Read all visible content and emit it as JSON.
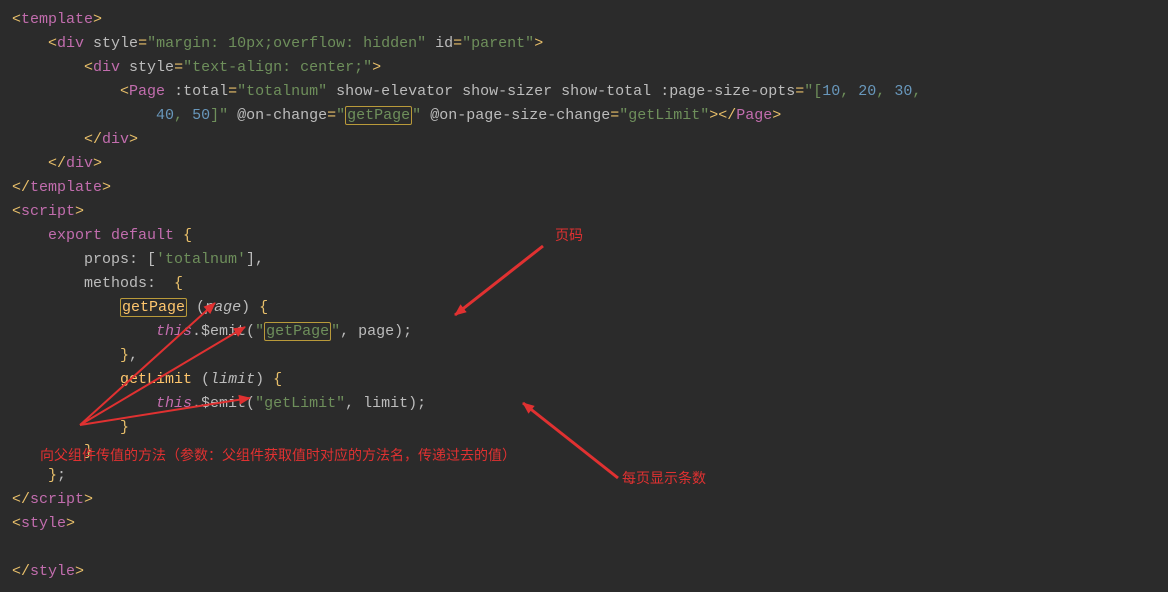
{
  "code": {
    "lines": [
      {
        "indent": 0,
        "tokens": [
          {
            "t": "pn",
            "v": "<"
          },
          {
            "t": "tag",
            "v": "template"
          },
          {
            "t": "pn",
            "v": ">"
          }
        ]
      },
      {
        "indent": 1,
        "tokens": [
          {
            "t": "pn",
            "v": "<"
          },
          {
            "t": "tag",
            "v": "div "
          },
          {
            "t": "attr",
            "v": "style"
          },
          {
            "t": "pn",
            "v": "="
          },
          {
            "t": "str",
            "v": "\"margin: 10px;overflow: hidden\""
          },
          {
            "t": "plain",
            "v": " "
          },
          {
            "t": "attr",
            "v": "id"
          },
          {
            "t": "pn",
            "v": "="
          },
          {
            "t": "str",
            "v": "\"parent\""
          },
          {
            "t": "pn",
            "v": ">"
          }
        ]
      },
      {
        "indent": 2,
        "tokens": [
          {
            "t": "pn",
            "v": "<"
          },
          {
            "t": "tag",
            "v": "div "
          },
          {
            "t": "attr",
            "v": "style"
          },
          {
            "t": "pn",
            "v": "="
          },
          {
            "t": "str",
            "v": "\"text-align: center;\""
          },
          {
            "t": "pn",
            "v": ">"
          }
        ]
      },
      {
        "indent": 3,
        "tokens": [
          {
            "t": "pn",
            "v": "<"
          },
          {
            "t": "tag",
            "v": "Page "
          },
          {
            "t": "attr",
            "v": ":total"
          },
          {
            "t": "pn",
            "v": "="
          },
          {
            "t": "str",
            "v": "\"totalnum\""
          },
          {
            "t": "plain",
            "v": " "
          },
          {
            "t": "attr",
            "v": "show-elevator show-sizer show-total "
          },
          {
            "t": "attr",
            "v": ":page-size-opts"
          },
          {
            "t": "pn",
            "v": "="
          },
          {
            "t": "str",
            "v": "\"["
          },
          {
            "t": "num",
            "v": "10"
          },
          {
            "t": "str",
            "v": ", "
          },
          {
            "t": "num",
            "v": "20"
          },
          {
            "t": "str",
            "v": ", "
          },
          {
            "t": "num",
            "v": "30"
          },
          {
            "t": "str",
            "v": ","
          }
        ]
      },
      {
        "indent": 4,
        "tokens": [
          {
            "t": "num",
            "v": "40"
          },
          {
            "t": "str",
            "v": ", "
          },
          {
            "t": "num",
            "v": "50"
          },
          {
            "t": "str",
            "v": "]\""
          },
          {
            "t": "plain",
            "v": " "
          },
          {
            "t": "attr",
            "v": "@on-change"
          },
          {
            "t": "pn",
            "v": "="
          },
          {
            "t": "str",
            "v": "\""
          },
          {
            "t": "mark-str",
            "v": "getPage"
          },
          {
            "t": "str",
            "v": "\""
          },
          {
            "t": "plain",
            "v": " "
          },
          {
            "t": "attr",
            "v": "@on-page-size-change"
          },
          {
            "t": "pn",
            "v": "="
          },
          {
            "t": "str",
            "v": "\"getLimit\""
          },
          {
            "t": "pn",
            "v": "></"
          },
          {
            "t": "tag",
            "v": "Page"
          },
          {
            "t": "pn",
            "v": ">"
          }
        ]
      },
      {
        "indent": 2,
        "tokens": [
          {
            "t": "pn",
            "v": "</"
          },
          {
            "t": "tag",
            "v": "div"
          },
          {
            "t": "pn",
            "v": ">"
          }
        ]
      },
      {
        "indent": 1,
        "tokens": [
          {
            "t": "pn",
            "v": "</"
          },
          {
            "t": "tag",
            "v": "div"
          },
          {
            "t": "pn",
            "v": ">"
          }
        ]
      },
      {
        "indent": 0,
        "tokens": [
          {
            "t": "pn",
            "v": "</"
          },
          {
            "t": "tag",
            "v": "template"
          },
          {
            "t": "pn",
            "v": ">"
          }
        ]
      },
      {
        "indent": 0,
        "tokens": [
          {
            "t": "pn",
            "v": "<"
          },
          {
            "t": "tag",
            "v": "script"
          },
          {
            "t": "pn",
            "v": ">"
          }
        ]
      },
      {
        "indent": 1,
        "tokens": [
          {
            "t": "kw",
            "v": "export default "
          },
          {
            "t": "pn",
            "v": "{"
          }
        ]
      },
      {
        "indent": 2,
        "tokens": [
          {
            "t": "plain",
            "v": "props: ["
          },
          {
            "t": "str",
            "v": "'totalnum'"
          },
          {
            "t": "plain",
            "v": "],"
          }
        ]
      },
      {
        "indent": 2,
        "tokens": [
          {
            "t": "plain",
            "v": "methods:  "
          },
          {
            "t": "pn",
            "v": "{"
          }
        ]
      },
      {
        "indent": 3,
        "tokens": [
          {
            "t": "mark-fn",
            "v": "getPage"
          },
          {
            "t": "plain",
            "v": " ("
          },
          {
            "t": "param",
            "v": "page"
          },
          {
            "t": "plain",
            "v": ") "
          },
          {
            "t": "pn",
            "v": "{"
          }
        ]
      },
      {
        "indent": 4,
        "tokens": [
          {
            "t": "thisk",
            "v": "this"
          },
          {
            "t": "plain",
            "v": ".$emit("
          },
          {
            "t": "str",
            "v": "\""
          },
          {
            "t": "mark-str",
            "v": "getPage"
          },
          {
            "t": "str",
            "v": "\""
          },
          {
            "t": "plain",
            "v": ", page);"
          }
        ]
      },
      {
        "indent": 3,
        "tokens": [
          {
            "t": "pn",
            "v": "}"
          },
          {
            "t": "plain",
            "v": ","
          }
        ]
      },
      {
        "indent": 3,
        "tokens": [
          {
            "t": "fn",
            "v": "getLimit"
          },
          {
            "t": "plain",
            "v": " ("
          },
          {
            "t": "param",
            "v": "limit"
          },
          {
            "t": "plain",
            "v": ") "
          },
          {
            "t": "pn",
            "v": "{"
          }
        ]
      },
      {
        "indent": 4,
        "tokens": [
          {
            "t": "thisk",
            "v": "this"
          },
          {
            "t": "plain",
            "v": ".$emit("
          },
          {
            "t": "str",
            "v": "\"getLimit\""
          },
          {
            "t": "plain",
            "v": ", limit);"
          }
        ]
      },
      {
        "indent": 3,
        "tokens": [
          {
            "t": "pn",
            "v": "}"
          }
        ]
      },
      {
        "indent": 2,
        "tokens": [
          {
            "t": "pn",
            "v": "}"
          }
        ]
      },
      {
        "indent": 1,
        "tokens": [
          {
            "t": "pn",
            "v": "}"
          },
          {
            "t": "plain",
            "v": ";"
          }
        ]
      },
      {
        "indent": 0,
        "tokens": [
          {
            "t": "pn",
            "v": "</"
          },
          {
            "t": "tag",
            "v": "script"
          },
          {
            "t": "pn",
            "v": ">"
          }
        ]
      },
      {
        "indent": 0,
        "tokens": [
          {
            "t": "pn",
            "v": "<"
          },
          {
            "t": "tag",
            "v": "style"
          },
          {
            "t": "pn",
            "v": ">"
          }
        ]
      },
      {
        "indent": 0,
        "tokens": [
          {
            "t": "plain",
            "v": ""
          }
        ]
      },
      {
        "indent": 0,
        "tokens": [
          {
            "t": "pn",
            "v": "</"
          },
          {
            "t": "tag",
            "v": "style"
          },
          {
            "t": "pn",
            "v": ">"
          }
        ]
      }
    ]
  },
  "annotations": {
    "page_label": "页码",
    "per_page_label": "每页显示条数",
    "emit_note": "向父组件传值的方法（参数：父组件获取值时对应的方法名，传递过去的值）"
  }
}
